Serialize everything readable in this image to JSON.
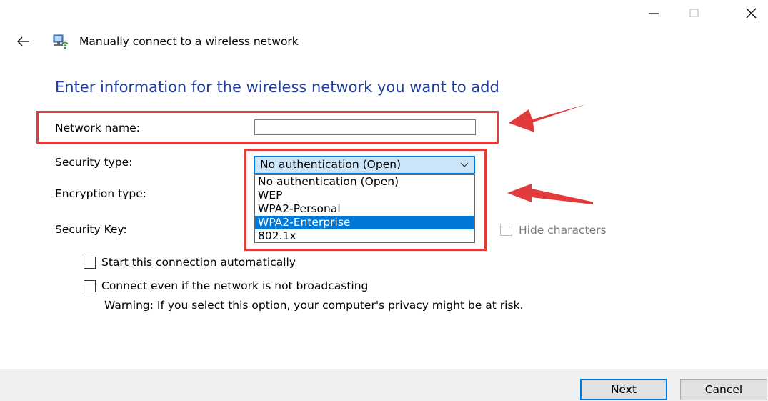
{
  "window": {
    "title": "Manually connect to a wireless network",
    "controls": {
      "minimize_icon": "minimize-icon",
      "maximize_icon": "maximize-icon",
      "close_icon": "close-icon"
    }
  },
  "page": {
    "heading": "Enter information for the wireless network you want to add"
  },
  "form": {
    "network_name_label": "Network name:",
    "network_name_value": "",
    "security_type_label": "Security type:",
    "security_type_selected": "No authentication (Open)",
    "security_type_options": [
      "No authentication (Open)",
      "WEP",
      "WPA2-Personal",
      "WPA2-Enterprise",
      "802.1x"
    ],
    "highlighted_option": "WPA2-Enterprise",
    "encryption_type_label": "Encryption type:",
    "security_key_label": "Security Key:",
    "hide_characters_label": "Hide characters",
    "start_auto_label": "Start this connection automatically",
    "connect_broadcast_label": "Connect even if the network is not broadcasting",
    "warning_text": "Warning: If you select this option, your computer's privacy might be at risk."
  },
  "footer": {
    "next_label": "Next",
    "cancel_label": "Cancel"
  },
  "colors": {
    "heading": "#1f3d99",
    "selection": "#0078d7",
    "annotation": "#e23b3b"
  }
}
